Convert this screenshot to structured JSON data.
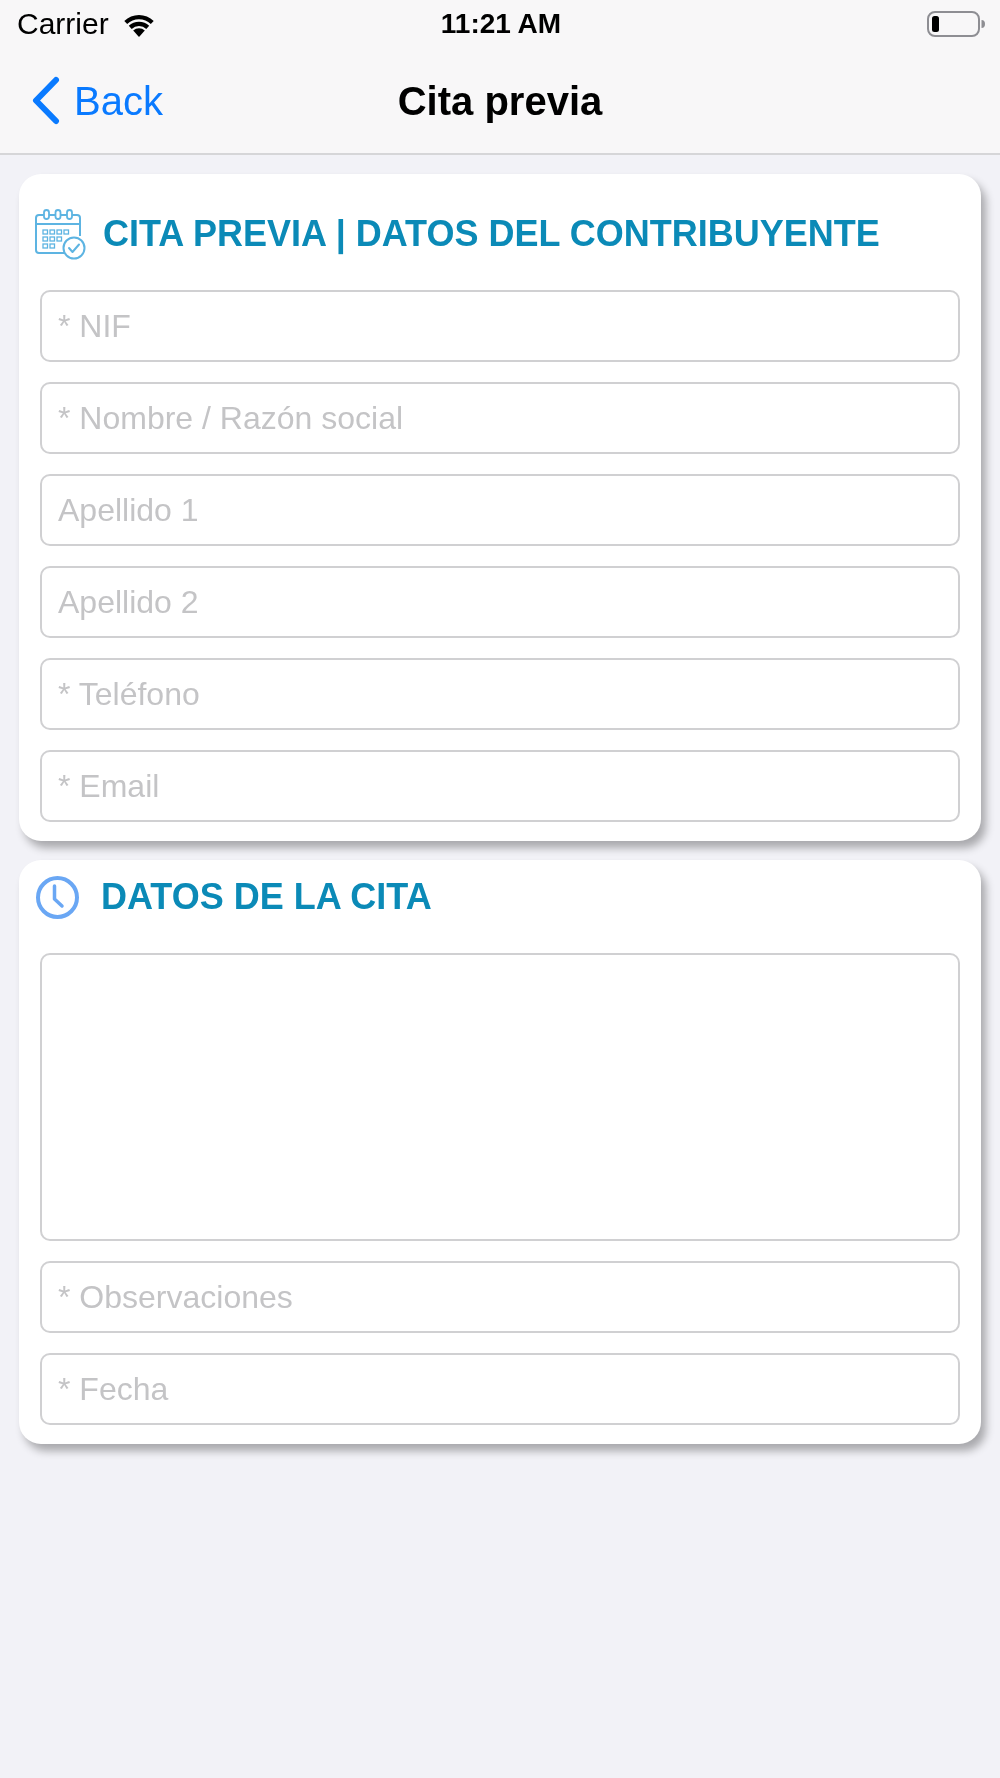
{
  "status_bar": {
    "carrier": "Carrier",
    "time": "11:21 AM"
  },
  "nav_bar": {
    "back": "Back",
    "title": "Cita previa"
  },
  "sections": [
    {
      "title": "CITA PREVIA | DATOS DEL CONTRIBUYENTE",
      "fields": [
        {
          "kind": "input",
          "placeholder": "* NIF"
        },
        {
          "kind": "input",
          "placeholder": "* Nombre / Razón social"
        },
        {
          "kind": "input",
          "placeholder": "Apellido 1"
        },
        {
          "kind": "input",
          "placeholder": "Apellido 2"
        },
        {
          "kind": "input",
          "placeholder": "* Teléfono"
        },
        {
          "kind": "input",
          "placeholder": "* Email"
        }
      ]
    },
    {
      "title": "DATOS DE LA CITA",
      "fields": [
        {
          "kind": "textarea"
        },
        {
          "kind": "input",
          "placeholder": "* Observaciones"
        },
        {
          "kind": "input",
          "placeholder": "* Fecha"
        }
      ]
    }
  ]
}
